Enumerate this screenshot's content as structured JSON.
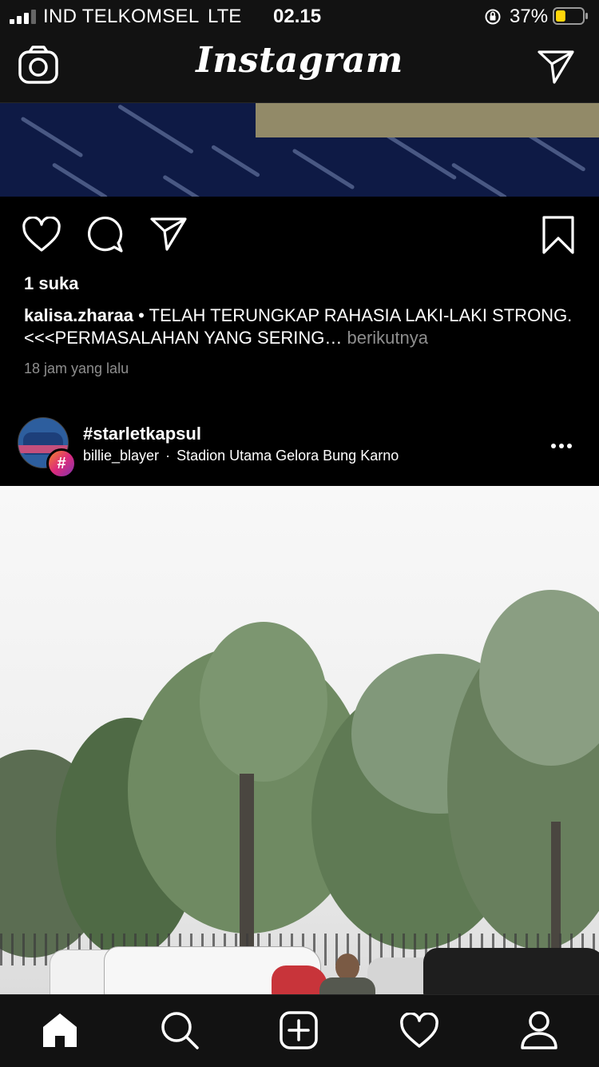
{
  "status_bar": {
    "carrier": "IND TELKOMSEL",
    "network": "LTE",
    "time": "02.15",
    "battery_percent": "37%",
    "battery_level": 0.37,
    "icons": [
      "signal-icon",
      "orientation-lock-icon",
      "battery-icon"
    ]
  },
  "header": {
    "logo": "Instagram",
    "left_icon": "camera-icon",
    "right_icon": "direct-message-icon"
  },
  "post1": {
    "actions": [
      "heart-icon",
      "comment-icon",
      "share-icon",
      "bookmark-icon"
    ],
    "likes": "1 suka",
    "username": "kalisa.zharaa",
    "caption": " • TELAH TERUNGKAP RAHASIA LAKI-LAKI STRONG. <<<PERMASALAHAN YANG SERING…",
    "more": "berikutnya",
    "timestamp": "18 jam yang lalu"
  },
  "post2": {
    "hashtag": "#starletkapsul",
    "badge": "#",
    "username": "billie_blayer",
    "separator": "·",
    "location": "Stadion Utama Gelora Bung Karno",
    "menu_icon": "more-options-icon"
  },
  "tab_bar": {
    "items": [
      "home-icon",
      "search-icon",
      "new-post-icon",
      "activity-icon",
      "profile-icon"
    ]
  },
  "colors": {
    "background": "#000000",
    "bar": "#121212",
    "secondary_text": "#8e8e8e",
    "battery": "#ffd60a"
  }
}
